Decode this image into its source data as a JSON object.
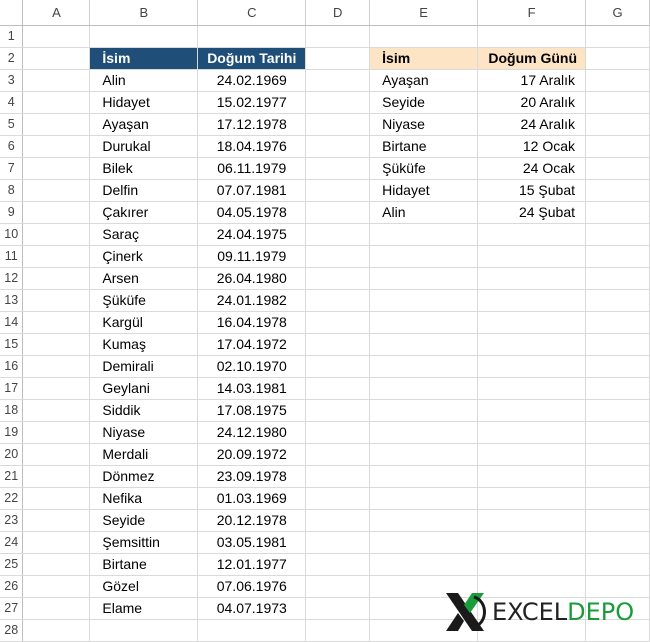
{
  "columns": [
    "A",
    "B",
    "C",
    "D",
    "E",
    "F",
    "G"
  ],
  "row_numbers": [
    "1",
    "2",
    "3",
    "4",
    "5",
    "6",
    "7",
    "8",
    "9",
    "10",
    "11",
    "12",
    "13",
    "14",
    "15",
    "16",
    "17",
    "18",
    "19",
    "20",
    "21",
    "22",
    "23",
    "24",
    "25",
    "26",
    "27",
    "28"
  ],
  "table1": {
    "header_name": "İsim",
    "header_date": "Doğum Tarihi",
    "header_color": "#1f4e78",
    "rows": [
      {
        "name": "Alin",
        "date": "24.02.1969"
      },
      {
        "name": "Hidayet",
        "date": "15.02.1977"
      },
      {
        "name": "Ayaşan",
        "date": "17.12.1978"
      },
      {
        "name": "Durukal",
        "date": "18.04.1976"
      },
      {
        "name": "Bilek",
        "date": "06.11.1979"
      },
      {
        "name": "Delfin",
        "date": "07.07.1981"
      },
      {
        "name": "Çakırer",
        "date": "04.05.1978"
      },
      {
        "name": "Saraç",
        "date": "24.04.1975"
      },
      {
        "name": "Çinerk",
        "date": "09.11.1979"
      },
      {
        "name": "Arsen",
        "date": "26.04.1980"
      },
      {
        "name": "Şüküfe",
        "date": "24.01.1982"
      },
      {
        "name": "Kargül",
        "date": "16.04.1978"
      },
      {
        "name": "Kumaş",
        "date": "17.04.1972"
      },
      {
        "name": "Demirali",
        "date": "02.10.1970"
      },
      {
        "name": "Geylani",
        "date": "14.03.1981"
      },
      {
        "name": "Siddik",
        "date": "17.08.1975"
      },
      {
        "name": "Niyase",
        "date": "24.12.1980"
      },
      {
        "name": "Merdali",
        "date": "20.09.1972"
      },
      {
        "name": "Dönmez",
        "date": "23.09.1978"
      },
      {
        "name": "Nefika",
        "date": "01.03.1969"
      },
      {
        "name": "Seyide",
        "date": "20.12.1978"
      },
      {
        "name": "Şemsittin",
        "date": "03.05.1981"
      },
      {
        "name": "Birtane",
        "date": "12.01.1977"
      },
      {
        "name": "Gözel",
        "date": "07.06.1976"
      },
      {
        "name": "Elame",
        "date": "04.07.1973"
      }
    ]
  },
  "table2": {
    "header_name": "İsim",
    "header_day": "Doğum Günü",
    "header_color": "#fce4c4",
    "rows": [
      {
        "name": "Ayaşan",
        "day": "17 Aralık"
      },
      {
        "name": "Seyide",
        "day": "20 Aralık"
      },
      {
        "name": "Niyase",
        "day": "24 Aralık"
      },
      {
        "name": "Birtane",
        "day": "12 Ocak"
      },
      {
        "name": "Şüküfe",
        "day": "24 Ocak"
      },
      {
        "name": "Hidayet",
        "day": "15 Şubat"
      },
      {
        "name": "Alin",
        "day": "24 Şubat"
      }
    ]
  },
  "logo": {
    "part1": "EXCEL",
    "part2": "DEPO",
    "accent_color": "#1a9c3a"
  }
}
